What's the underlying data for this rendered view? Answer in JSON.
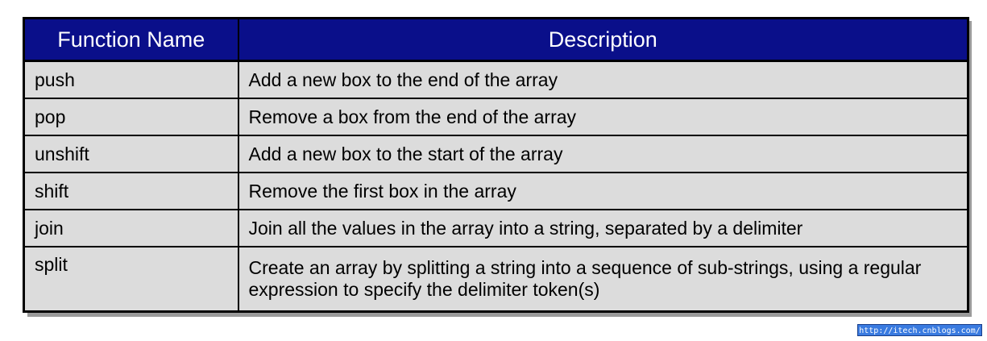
{
  "table": {
    "headers": [
      "Function Name",
      "Description"
    ],
    "rows": [
      {
        "name": "push",
        "description": "Add a new box to the end of the array"
      },
      {
        "name": "pop",
        "description": "Remove a box from the end of the array"
      },
      {
        "name": "unshift",
        "description": "Add a new box to the start of the array"
      },
      {
        "name": "shift",
        "description": "Remove the first box in the array"
      },
      {
        "name": "join",
        "description": "Join all the values in the array into a string, separated by a delimiter"
      },
      {
        "name": "split",
        "description": "Create an array by splitting a string into a sequence of sub-strings, using a regular expression to specify the delimiter token(s)"
      }
    ]
  },
  "watermark": {
    "text": "http://itech.cnblogs.com/"
  },
  "colors": {
    "header_background": "#0a0f8a",
    "header_text": "#ffffff",
    "cell_background": "#dcdcdc",
    "border": "#000000"
  }
}
